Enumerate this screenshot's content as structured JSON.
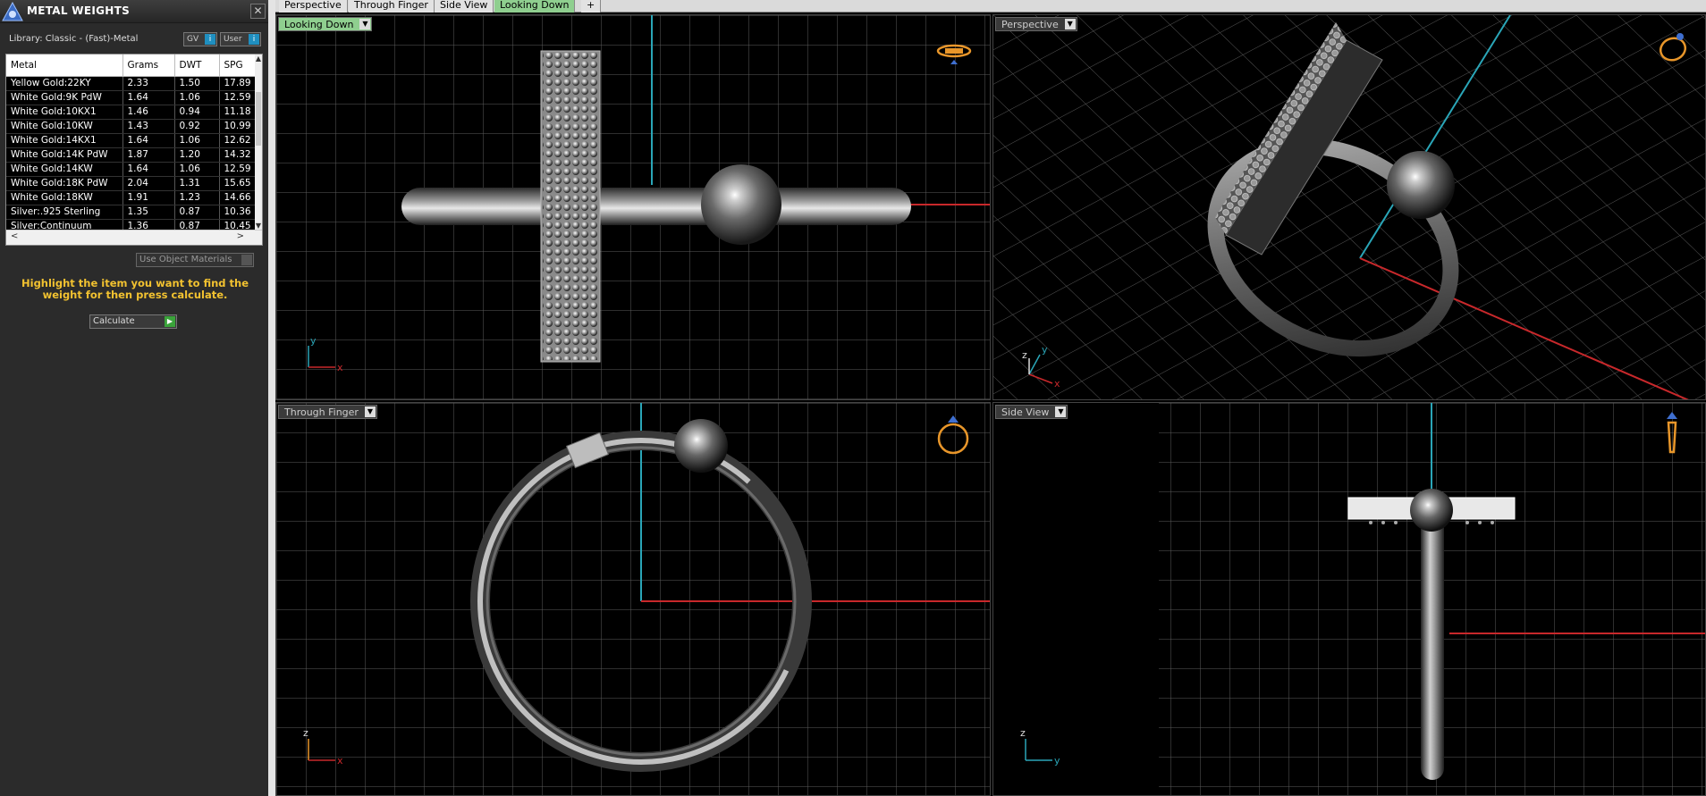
{
  "panel": {
    "title": "METAL WEIGHTS",
    "close_label": "✕",
    "library_label": "Library: Classic - (Fast)-Metal",
    "gv_label": "GV",
    "user_label": "User",
    "toggle_indicator": "i",
    "columns": [
      "Metal",
      "Grams",
      "DWT",
      "SPG"
    ],
    "rows": [
      [
        "Yellow Gold:22KY",
        "2.33",
        "1.50",
        "17.89"
      ],
      [
        "White Gold:9K PdW",
        "1.64",
        "1.06",
        "12.59"
      ],
      [
        "White Gold:10KX1",
        "1.46",
        "0.94",
        "11.18"
      ],
      [
        "White Gold:10KW",
        "1.43",
        "0.92",
        "10.99"
      ],
      [
        "White Gold:14KX1",
        "1.64",
        "1.06",
        "12.62"
      ],
      [
        "White Gold:14K PdW",
        "1.87",
        "1.20",
        "14.32"
      ],
      [
        "White Gold:14KW",
        "1.64",
        "1.06",
        "12.59"
      ],
      [
        "White Gold:18K PdW",
        "2.04",
        "1.31",
        "15.65"
      ],
      [
        "White Gold:18KW",
        "1.91",
        "1.23",
        "14.66"
      ],
      [
        "Silver:.925 Sterling",
        "1.35",
        "0.87",
        "10.36"
      ],
      [
        "Silver:Continuum",
        "1.36",
        "0.87",
        "10.45"
      ]
    ],
    "use_object_materials_label": "Use Object Materials",
    "hint": "Highlight the item you want to find the weight for then press calculate.",
    "calculate_label": "Calculate",
    "calculate_icon": "▶"
  },
  "tabs": [
    {
      "label": "Perspective",
      "active": false
    },
    {
      "label": "Through Finger",
      "active": false
    },
    {
      "label": "Side View",
      "active": false
    },
    {
      "label": "Looking Down",
      "active": true
    },
    {
      "label": "+",
      "active": false
    }
  ],
  "viewports": {
    "top": {
      "label": "Looking Down",
      "axis_h": "x",
      "axis_v": "y"
    },
    "perspective": {
      "label": "Perspective",
      "axis_h": "x",
      "axis_v": "y",
      "axis_z": "z"
    },
    "front": {
      "label": "Through Finger",
      "axis_h": "x",
      "axis_v": "z"
    },
    "side": {
      "label": "Side View",
      "axis_h": "y",
      "axis_v": "z"
    }
  },
  "colors": {
    "grid": "#6b6b6b",
    "axis_x": "#c8282b",
    "axis_y": "#2aa6b8",
    "active_tab": "#8fcf8f",
    "hint": "#f2c230",
    "icon_orange": "#e8962a"
  }
}
